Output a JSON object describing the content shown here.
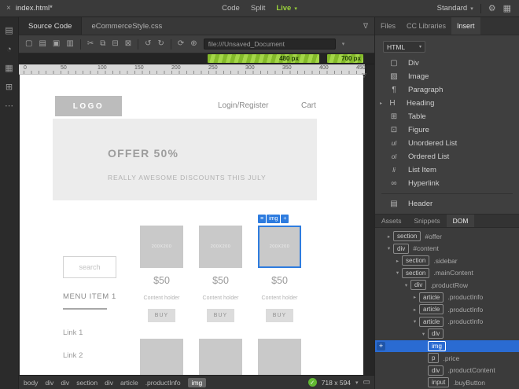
{
  "topbar": {
    "file_tab": {
      "close_icon": "×",
      "title": "index.html*"
    },
    "modes": {
      "code": "Code",
      "split": "Split",
      "live": "Live"
    },
    "workspace": "Standard"
  },
  "files_row": {
    "source_tab": "Source Code",
    "related_file": "eCommerceStyle.css"
  },
  "toolbar": {
    "address": "file:///Unsaved_Document"
  },
  "measure": {
    "bar1": "480 px",
    "bar2": "700 px"
  },
  "ruler": {
    "ticks": [
      "0",
      "50",
      "100",
      "150",
      "200",
      "250",
      "300",
      "350",
      "400",
      "450"
    ]
  },
  "page": {
    "logo": "LOGO",
    "nav_login": "Login/Register",
    "nav_cart": "Cart",
    "hero_title": "OFFER 50%",
    "hero_subtitle": "REALLY AWESOME DISCOUNTS THIS JULY",
    "search_placeholder": "search",
    "menu_title": "MENU ITEM 1",
    "link1": "Link 1",
    "link2": "Link 2",
    "products": [
      {
        "image_label": "200X200",
        "price": "$50",
        "description": "Content holder",
        "buy": "BUY"
      },
      {
        "image_label": "200X200",
        "price": "$50",
        "description": "Content holder",
        "buy": "BUY"
      },
      {
        "image_label": "200X200",
        "price": "$50",
        "description": "Content holder",
        "buy": "BUY"
      }
    ],
    "selection_tag": {
      "menu": "≡",
      "label": "img",
      "add": "+"
    }
  },
  "statusbar": {
    "crumbs": [
      "body",
      "div",
      "div",
      "section",
      "div",
      "article",
      ".productInfo",
      "img"
    ],
    "size": "718 x 594"
  },
  "right_panel": {
    "tabs": [
      "Files",
      "CC Libraries",
      "Insert"
    ],
    "insert": {
      "category": "HTML",
      "items": [
        {
          "icon": "▢",
          "label": "Div"
        },
        {
          "icon": "▨",
          "label": "Image"
        },
        {
          "icon": "¶",
          "label": "Paragraph"
        },
        {
          "icon": "H",
          "label": "Heading"
        },
        {
          "icon": "⊞",
          "label": "Table"
        },
        {
          "icon": "⊡",
          "label": "Figure"
        },
        {
          "icon": "ul",
          "label": "Unordered List"
        },
        {
          "icon": "ol",
          "label": "Ordered List"
        },
        {
          "icon": "li",
          "label": "List Item"
        },
        {
          "icon": "∞",
          "label": "Hyperlink"
        },
        {
          "icon": "▤",
          "label": "Header"
        }
      ]
    },
    "bottom_tabs": [
      "Assets",
      "Snippets",
      "DOM"
    ],
    "dom_rows": [
      {
        "arrow": "▸",
        "tag": "section",
        "qual": "#offer"
      },
      {
        "arrow": "▾",
        "tag": "div",
        "qual": "#content"
      },
      {
        "arrow": "▸",
        "tag": "section",
        "qual": ".sidebar"
      },
      {
        "arrow": "▾",
        "tag": "section",
        "qual": ".mainContent"
      },
      {
        "arrow": "▾",
        "tag": "div",
        "qual": ".productRow"
      },
      {
        "arrow": "▸",
        "tag": "article",
        "qual": ".productInfo"
      },
      {
        "arrow": "▸",
        "tag": "article",
        "qual": ".productInfo"
      },
      {
        "arrow": "▾",
        "tag": "article",
        "qual": ".productInfo"
      },
      {
        "arrow": "▾",
        "tag": "div",
        "qual": ""
      },
      {
        "arrow": "",
        "tag": "img",
        "qual": ""
      },
      {
        "arrow": "",
        "tag": "p",
        "qual": ".price"
      },
      {
        "arrow": "",
        "tag": "div",
        "qual": ".productContent"
      },
      {
        "arrow": "",
        "tag": "input",
        "qual": ".buyButton"
      }
    ]
  },
  "icons": {
    "caret_down": "▾",
    "gear": "⚙",
    "layout": "▦",
    "filter": "∇",
    "undo": "↺",
    "redo": "↻",
    "refresh": "⟳",
    "globe": "⊕",
    "check": "✓",
    "plus": "+",
    "marker": "▽",
    "expand": "▸",
    "device": "▭",
    "toolbar": [
      "▢",
      "▤",
      "▣",
      "▥",
      "✂",
      "⧉",
      "⊟",
      "⊠"
    ],
    "rail": [
      "▤",
      "◔",
      "▦",
      "⊞",
      "⋯"
    ]
  },
  "colors": {
    "live_green": "#9bd33a",
    "measure_green": "#97cc36",
    "selection_blue": "#2e7cdf",
    "dom_selected_blue": "#2a6bd2"
  }
}
